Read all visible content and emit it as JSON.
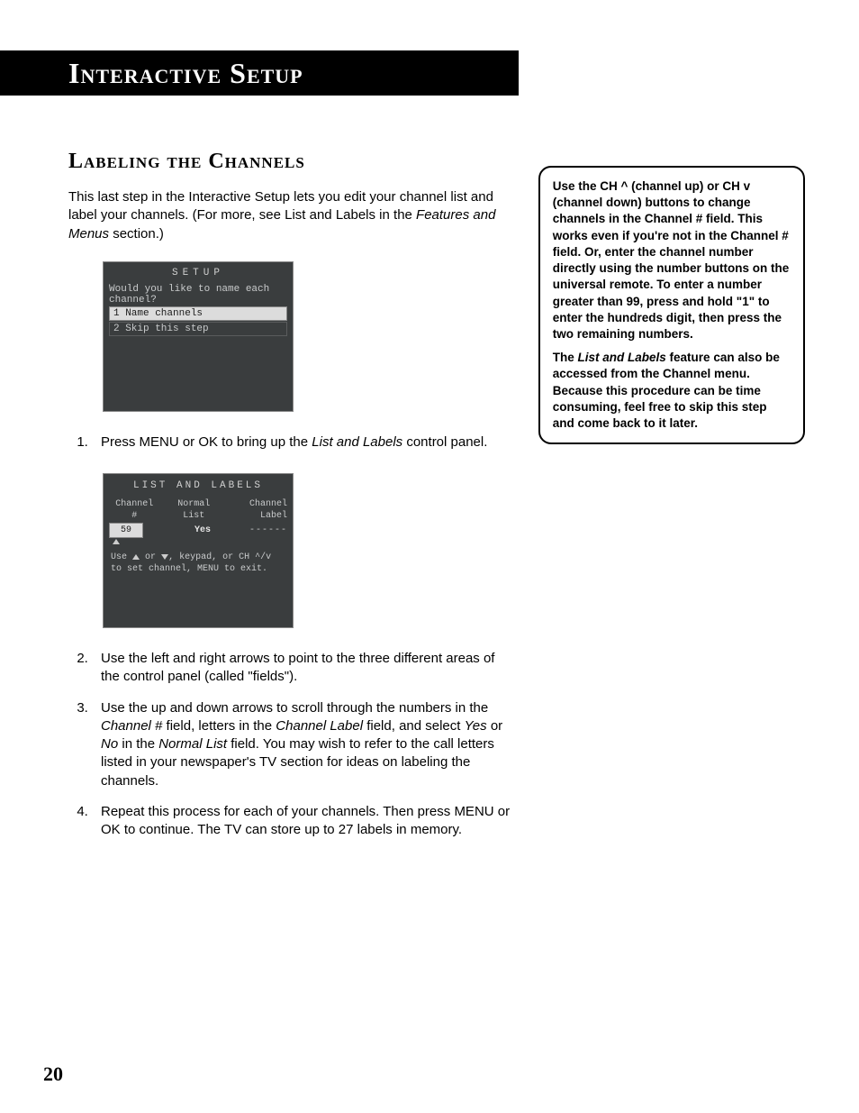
{
  "banner": "Interactive Setup",
  "section_title": "Labeling the Channels",
  "intro_a": "This last step in the Interactive Setup lets you edit your channel list and label your channels. (For more, see List and Labels in the ",
  "intro_b": "Features and Menus",
  "intro_c": " section.)",
  "osd1": {
    "title": "SETUP",
    "prompt": "Would you like to name each channel?",
    "opt1": "1 Name channels",
    "opt2": "2 Skip this step"
  },
  "step1_a": "Press MENU or OK to bring up the ",
  "step1_b": "List and Labels",
  "step1_c": " control panel.",
  "osd2": {
    "title": "LIST AND LABELS",
    "h1a": "Channel",
    "h1b": "#",
    "h2a": "Normal",
    "h2b": "List",
    "h3a": "Channel",
    "h3b": "Label",
    "channel": "59",
    "normal": "Yes",
    "label": "------",
    "help1": "Use",
    "help2": "or",
    "help3": ", keypad,  or CH ^/v",
    "help4": "to set channel, MENU to exit."
  },
  "step2": "Use the left and right arrows to point to the three different areas of the control panel (called \"fields\").",
  "step3_a": "Use the up and down arrows to scroll through the numbers in the ",
  "step3_b": "Channel #",
  "step3_c": " field, letters in the ",
  "step3_d": "Channel Label",
  "step3_e": " field, and select ",
  "step3_f": "Yes",
  "step3_g": " or ",
  "step3_h": "No",
  "step3_i": " in the ",
  "step3_j": "Normal List",
  "step3_k": " field. You may wish to refer to the call letters listed in your newspaper's TV section for ideas on labeling the channels.",
  "step4": "Repeat this process for each of your channels. Then press MENU or OK to continue. The TV can store up to 27 labels in memory.",
  "side": {
    "p1": "Use the CH ^ (channel up) or CH v (channel down) buttons to change channels in the Channel # field. This works even if you're not in the Channel # field. Or, enter the channel number directly using the number buttons on the universal remote. To enter a number greater than 99, press and hold \"1\" to enter the hundreds digit, then press the two remaining numbers.",
    "p2a": "The ",
    "p2b": "List and Labels",
    "p2c": " feature can also be accessed from the Channel menu. Because this procedure can be time consuming, feel free to skip this step and come back to it later."
  },
  "pagenum": "20"
}
